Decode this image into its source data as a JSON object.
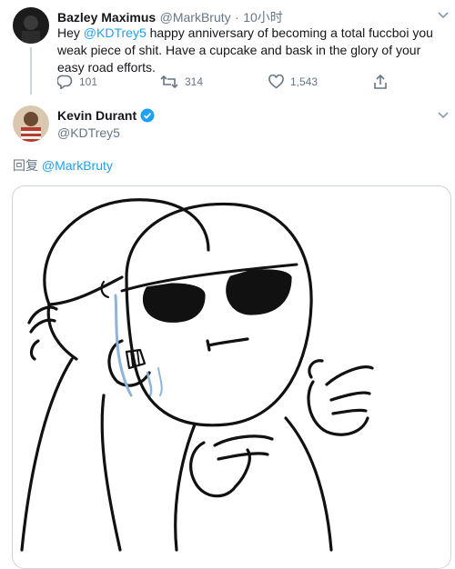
{
  "tweet1": {
    "name": "Bazley Maximus",
    "handle": "@MarkBruty",
    "separator": "·",
    "time": "10小时",
    "text_prefix": "Hey ",
    "mention": "@KDTrey5",
    "text_suffix": " happy anniversary of becoming a total fuccboi you weak piece of shit. Have a cupcake and bask in the glory of your easy road efforts.",
    "actions": {
      "reply_count": "101",
      "retweet_count": "314",
      "like_count": "1,543"
    }
  },
  "tweet2": {
    "name": "Kevin Durant",
    "handle": "@KDTrey5",
    "reply_prefix": "回复 ",
    "reply_mention": "@MarkBruty"
  },
  "colors": {
    "accent": "#1da1f2",
    "muted": "#657786",
    "border": "#ccd6dd"
  }
}
